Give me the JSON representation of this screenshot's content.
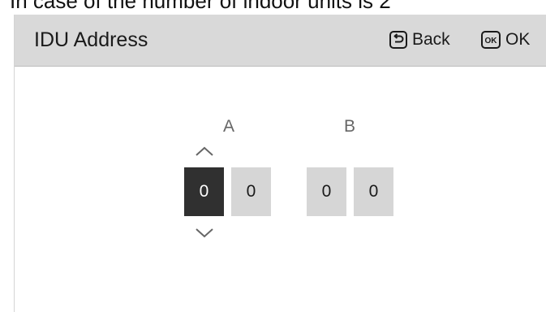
{
  "caption": "In case of the number of indoor units is 2",
  "header": {
    "title": "IDU Address",
    "back_label": "Back",
    "ok_label": "OK",
    "ok_icon_text": "OK"
  },
  "groups": [
    {
      "label": "A",
      "digits": [
        "0",
        "0"
      ]
    },
    {
      "label": "B",
      "digits": [
        "0",
        "0"
      ]
    }
  ],
  "selected_digit": "A.1",
  "icons": {
    "back": "return-arrow-icon",
    "ok": "ok-key-icon",
    "up": "chevron-up-icon",
    "down": "chevron-down-icon"
  },
  "colors": {
    "header_bg": "#d9d9d9",
    "digit_bg": "#d6d6d6",
    "digit_selected_bg": "#303030",
    "label_text": "#666666"
  }
}
